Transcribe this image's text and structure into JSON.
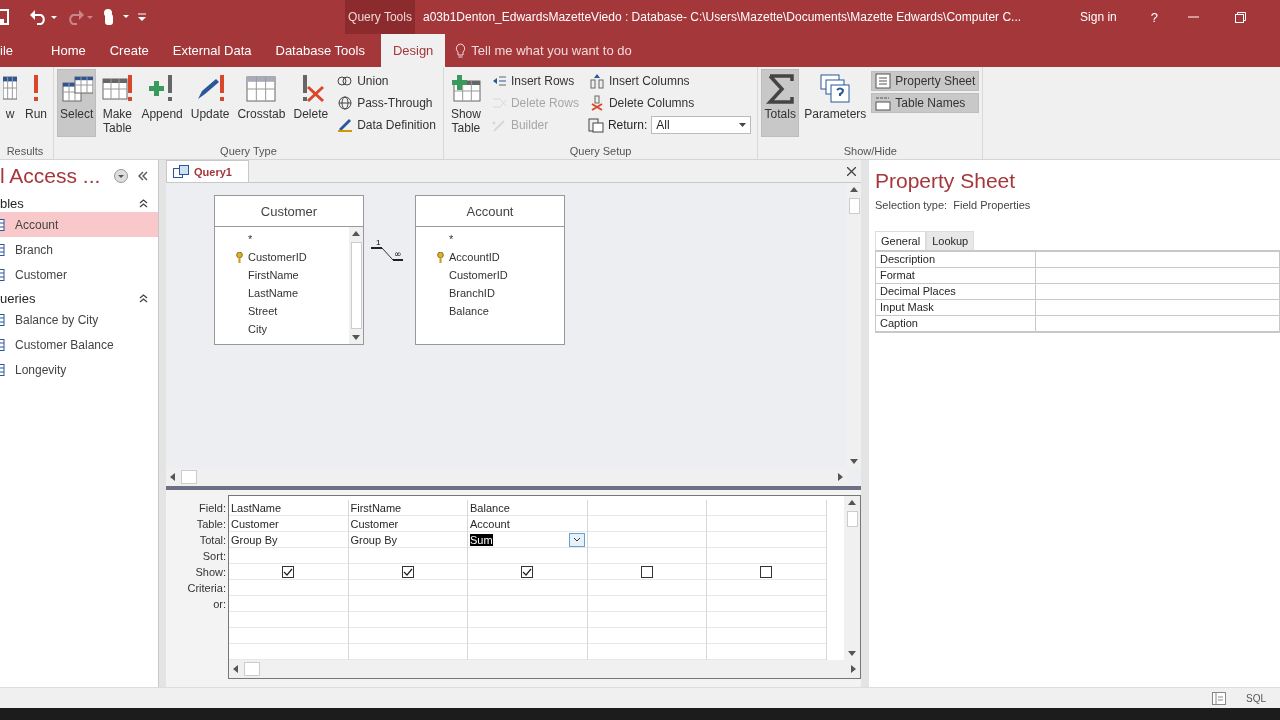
{
  "title_bar": {
    "context_label": "Query Tools",
    "title": "a03b1Denton_EdwardsMazetteViedo : Database- C:\\Users\\Mazette\\Documents\\Mazette Edwards\\Computer C...",
    "sign_in": "Sign in",
    "help": "?"
  },
  "tabs": [
    {
      "label": "ile",
      "selected": false
    },
    {
      "label": "Home",
      "selected": false
    },
    {
      "label": "Create",
      "selected": false
    },
    {
      "label": "External Data",
      "selected": false
    },
    {
      "label": "Database Tools",
      "selected": false
    },
    {
      "label": "Design",
      "selected": true
    }
  ],
  "tell_me": "Tell me what you want to do",
  "ribbon": {
    "groups": [
      {
        "label": "Results",
        "controls": [
          {
            "kind": "large",
            "label": "w",
            "selected": false,
            "disabled": false
          },
          {
            "kind": "large",
            "label": "Run",
            "selected": false,
            "disabled": false
          }
        ]
      },
      {
        "label": "Query Type",
        "controls": [
          {
            "kind": "large",
            "label": "Select",
            "selected": true,
            "disabled": false
          },
          {
            "kind": "large",
            "label": "Make Table",
            "selected": false,
            "disabled": false
          },
          {
            "kind": "large",
            "label": "Append",
            "selected": false,
            "disabled": false
          },
          {
            "kind": "large",
            "label": "Update",
            "selected": false,
            "disabled": false
          },
          {
            "kind": "large",
            "label": "Crosstab",
            "selected": false,
            "disabled": false
          },
          {
            "kind": "large",
            "label": "Delete",
            "selected": false,
            "disabled": false
          },
          {
            "kind": "stack",
            "items": [
              {
                "kind": "small",
                "label": "Union",
                "selected": false,
                "disabled": false
              },
              {
                "kind": "small",
                "label": "Pass-Through",
                "selected": false,
                "disabled": false
              },
              {
                "kind": "small",
                "label": "Data Definition",
                "selected": false,
                "disabled": false
              }
            ]
          }
        ]
      },
      {
        "label": "Query Setup",
        "controls": [
          {
            "kind": "large",
            "label": "Show Table",
            "selected": false,
            "disabled": false
          },
          {
            "kind": "stack",
            "items": [
              {
                "kind": "small",
                "label": "Insert Rows",
                "selected": false,
                "disabled": false
              },
              {
                "kind": "small",
                "label": "Delete Rows",
                "selected": false,
                "disabled": true
              },
              {
                "kind": "small",
                "label": "Builder",
                "selected": false,
                "disabled": true
              }
            ]
          },
          {
            "kind": "stack",
            "items": [
              {
                "kind": "small",
                "label": "Insert Columns",
                "selected": false,
                "disabled": false
              },
              {
                "kind": "small",
                "label": "Delete Columns",
                "selected": false,
                "disabled": false
              },
              {
                "kind": "dropdown",
                "label": "Return:",
                "value": "All"
              }
            ]
          }
        ]
      },
      {
        "label": "Show/Hide",
        "controls": [
          {
            "kind": "large",
            "label": "Totals",
            "selected": true,
            "disabled": false
          },
          {
            "kind": "large",
            "label": "Parameters",
            "selected": false,
            "disabled": false
          },
          {
            "kind": "stack",
            "items": [
              {
                "kind": "small",
                "label": "Property Sheet",
                "selected": true,
                "disabled": false
              },
              {
                "kind": "small",
                "label": "Table Names",
                "selected": true,
                "disabled": false
              }
            ]
          }
        ]
      }
    ]
  },
  "navigation": {
    "title": "l Access ...",
    "sections": [
      {
        "label": "bles",
        "items": [
          {
            "label": "Account",
            "selected": true
          },
          {
            "label": "Branch",
            "selected": false
          },
          {
            "label": "Customer",
            "selected": false
          }
        ]
      },
      {
        "label": "ueries",
        "items": [
          {
            "label": "Balance by City",
            "selected": false
          },
          {
            "label": "Customer Balance",
            "selected": false
          },
          {
            "label": "Longevity",
            "selected": false
          }
        ]
      }
    ]
  },
  "query": {
    "tab": "Query1",
    "tables": [
      {
        "name": "Customer",
        "scrollbar": true,
        "fields": [
          {
            "name": "*",
            "key": false
          },
          {
            "name": "CustomerID",
            "key": true
          },
          {
            "name": "FirstName",
            "key": false
          },
          {
            "name": "LastName",
            "key": false
          },
          {
            "name": "Street",
            "key": false
          },
          {
            "name": "City",
            "key": false
          }
        ]
      },
      {
        "name": "Account",
        "scrollbar": false,
        "fields": [
          {
            "name": "*",
            "key": false
          },
          {
            "name": "AccountID",
            "key": true
          },
          {
            "name": "CustomerID",
            "key": false
          },
          {
            "name": "BranchID",
            "key": false
          },
          {
            "name": "Balance",
            "key": false
          }
        ]
      }
    ],
    "join": {
      "one": "1",
      "many": "∞"
    },
    "grid": {
      "row_labels": [
        "Field:",
        "Table:",
        "Total:",
        "Sort:",
        "Show:",
        "Criteria:",
        "or:"
      ],
      "columns": [
        {
          "field": "LastName",
          "table": "Customer",
          "total": "Group By",
          "show": true,
          "selected": false
        },
        {
          "field": "FirstName",
          "table": "Customer",
          "total": "Group By",
          "show": true,
          "selected": false
        },
        {
          "field": "Balance",
          "table": "Account",
          "total": "Sum",
          "show": true,
          "selected": true
        },
        {
          "show": false,
          "selected": false
        },
        {
          "show": false,
          "selected": false
        }
      ]
    }
  },
  "property_sheet": {
    "title": "Property Sheet",
    "selection_type": "Selection type:  Field Properties",
    "tabs": [
      {
        "label": "General",
        "selected": true
      },
      {
        "label": "Lookup",
        "selected": false
      }
    ],
    "properties": [
      "Description",
      "Format",
      "Decimal Places",
      "Input Mask",
      "Caption"
    ]
  },
  "status_bar": {
    "sql": "SQL"
  }
}
